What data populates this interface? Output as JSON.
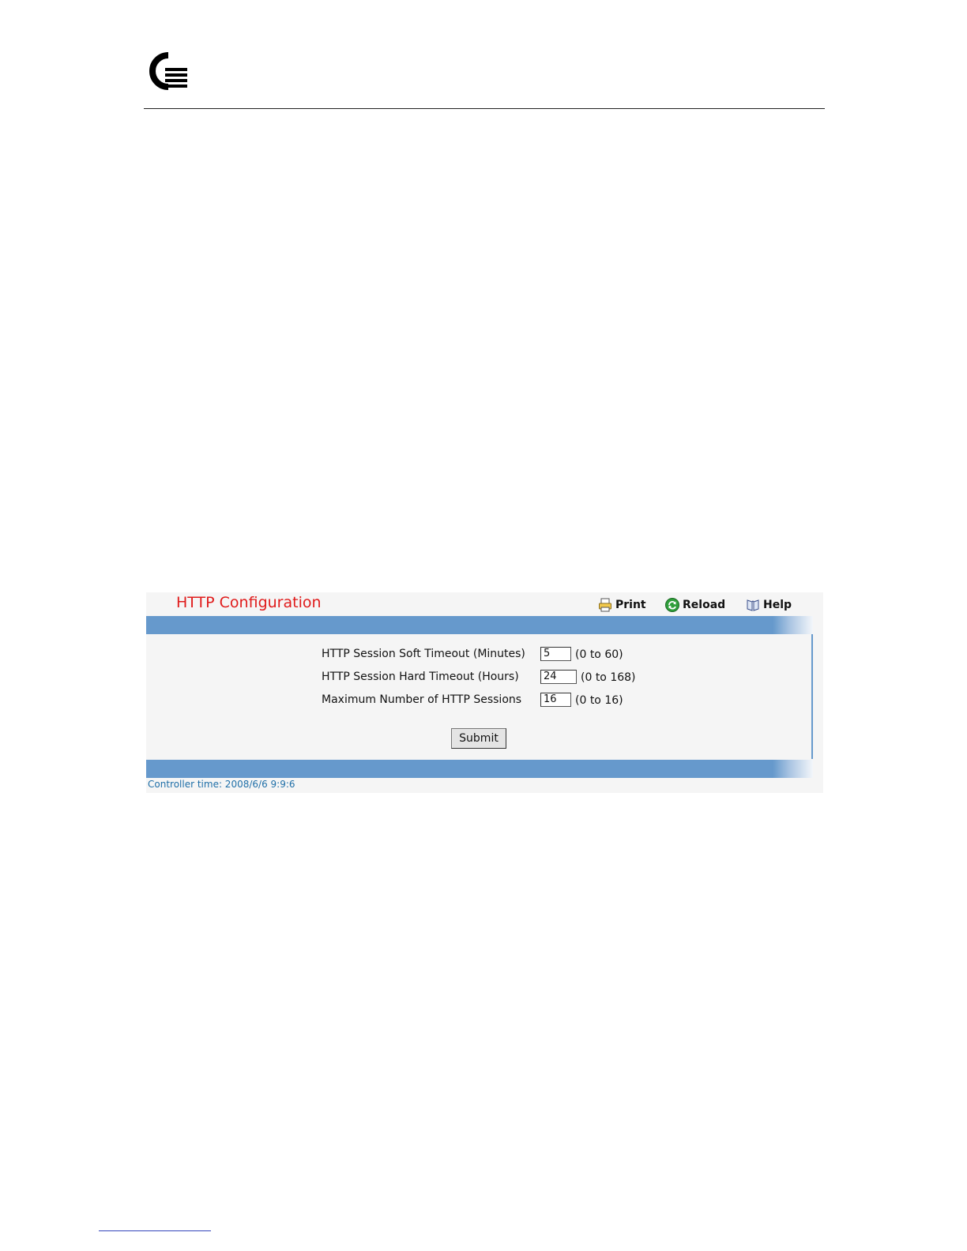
{
  "page": {
    "logo": "Q-logo"
  },
  "panel": {
    "title": "HTTP Configuration",
    "toolbar": {
      "print_label": "Print",
      "reload_label": "Reload",
      "help_label": "Help"
    },
    "fields": [
      {
        "label": "HTTP Session Soft Timeout (Minutes)",
        "value": "5",
        "range": "(0 to 60)"
      },
      {
        "label": "HTTP Session Hard Timeout (Hours)",
        "value": "24",
        "range": "(0 to 168)"
      },
      {
        "label": "Maximum Number of HTTP Sessions",
        "value": "16",
        "range": "(0 to 16)"
      }
    ],
    "submit_label": "Submit",
    "controller_time": "Controller time: 2008/6/6 9:9:6"
  },
  "colors": {
    "title": "#e01b1b",
    "bar": "#6699cc",
    "controller_time": "#1f6fa8"
  }
}
